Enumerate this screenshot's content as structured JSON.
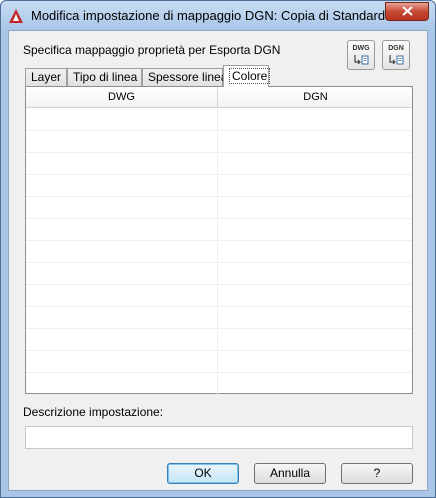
{
  "window": {
    "title": "Modifica impostazione di mappaggio DGN: Copia di Standard",
    "close_symbol": "✕"
  },
  "spec_label": "Specifica mappaggio proprietà per Esporta DGN",
  "icon_buttons": {
    "dwg_to_dgn": {
      "label": "DWG",
      "icon": "dwg-to-dgn-icon"
    },
    "dgn_to_dwg": {
      "label": "DGN",
      "icon": "dgn-to-dwg-icon"
    }
  },
  "tabs": [
    "Layer",
    "Tipo di linea",
    "Spessore linea",
    "Colore"
  ],
  "active_tab": "Colore",
  "grid": {
    "columns": [
      "DWG",
      "DGN"
    ],
    "rows": []
  },
  "description": {
    "label": "Descrizione impostazione:",
    "value": ""
  },
  "buttons": {
    "ok": "OK",
    "cancel": "Annulla",
    "help": "?"
  },
  "colors": {
    "title_bar": "#a9c6e8",
    "close_button": "#c74a36",
    "dialog_bg": "#f0f0f0"
  }
}
